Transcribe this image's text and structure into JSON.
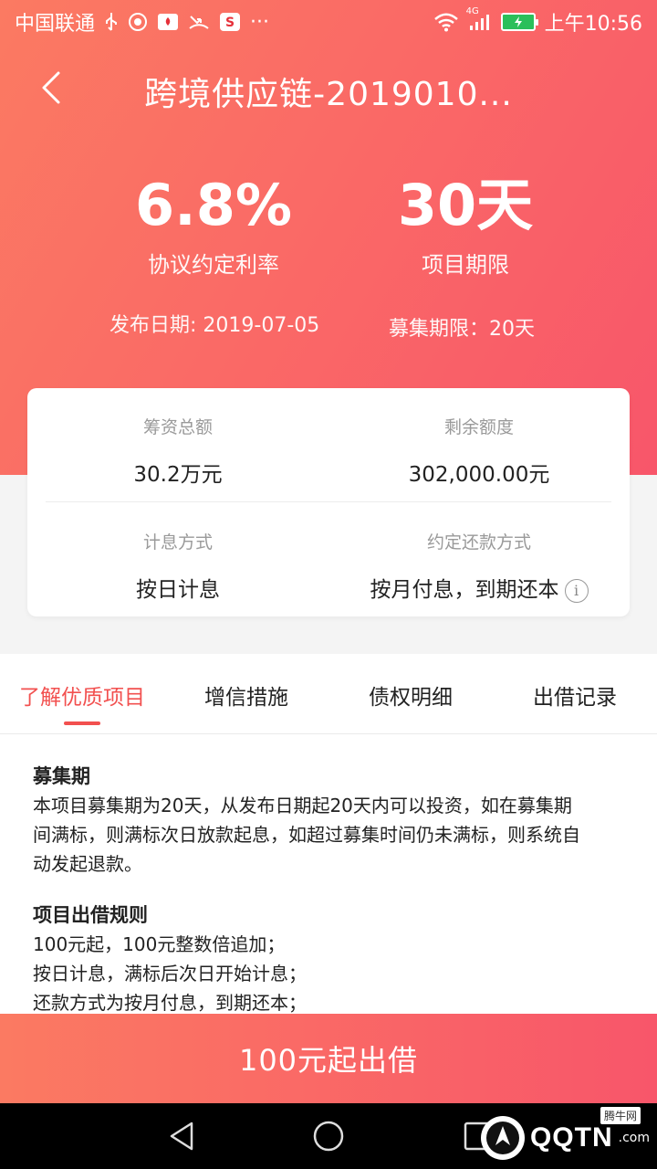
{
  "status_bar": {
    "carrier": "中国联通",
    "more": "···",
    "network": "4G",
    "time": "上午10:56"
  },
  "nav": {
    "title": "跨境供应链-2019010..."
  },
  "stats": {
    "rate_value": "6.8%",
    "rate_label": "协议约定利率",
    "term_value": "30天",
    "term_label": "项目期限",
    "publish_date": "发布日期: 2019-07-05",
    "raise_period": "募集期限：20天"
  },
  "card": {
    "total_label": "筹资总额",
    "total_value": "30.2万元",
    "remain_label": "剩余额度",
    "remain_value": "302,000.00元",
    "interest_label": "计息方式",
    "interest_value": "按日计息",
    "repay_label": "约定还款方式",
    "repay_value": "按月付息，到期还本"
  },
  "tabs": [
    {
      "label": "了解优质项目"
    },
    {
      "label": "增信措施"
    },
    {
      "label": "债权明细"
    },
    {
      "label": "出借记录"
    }
  ],
  "content": {
    "sec1_title": "募集期",
    "sec1_line1": "本项目募集期为20天，从发布日期起20天内可以投资，如在募集期",
    "sec1_line2": "间满标，则满标次日放款起息，如超过募集时间仍未满标，则系统自",
    "sec1_line3": "动发起退款。",
    "sec2_title": "项目出借规则",
    "sec2_line1": "100元起，100元整数倍追加；",
    "sec2_line2": "按日计息，满标后次日开始计息；",
    "sec2_line3": "还款方式为按月付息，到期还本；"
  },
  "cta": {
    "label": "100元起出借"
  },
  "watermark": {
    "text": "QQTN",
    "suffix": ".com",
    "tag": "腾牛网"
  },
  "colors": {
    "accent": "#f2504f",
    "hero_start": "#fb7a62",
    "hero_end": "#f8566a"
  }
}
